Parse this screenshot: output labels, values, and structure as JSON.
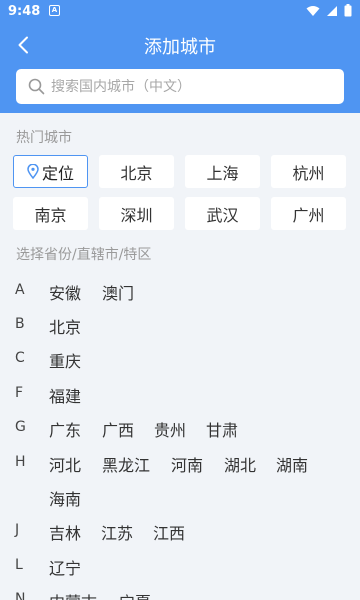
{
  "status": {
    "time": "9:48",
    "notif_icon": "A"
  },
  "nav": {
    "title": "添加城市"
  },
  "search": {
    "placeholder": "搜索国内城市（中文）"
  },
  "hot": {
    "label": "热门城市",
    "locate_label": "定位",
    "cities": [
      "北京",
      "上海",
      "杭州",
      "南京",
      "深圳",
      "武汉",
      "广州"
    ]
  },
  "provinces": {
    "label": "选择省份/直辖市/特区",
    "groups": [
      {
        "letter": "A",
        "items": [
          "安徽",
          "澳门"
        ]
      },
      {
        "letter": "B",
        "items": [
          "北京"
        ]
      },
      {
        "letter": "C",
        "items": [
          "重庆"
        ]
      },
      {
        "letter": "F",
        "items": [
          "福建"
        ]
      },
      {
        "letter": "G",
        "items": [
          "广东",
          "广西",
          "贵州",
          "甘肃"
        ]
      },
      {
        "letter": "H",
        "items": [
          "河北",
          "黑龙江",
          "河南",
          "湖北",
          "湖南"
        ]
      },
      {
        "letter": "",
        "items": [
          "海南"
        ]
      },
      {
        "letter": "J",
        "items": [
          "吉林",
          "江苏",
          "江西"
        ]
      },
      {
        "letter": "L",
        "items": [
          "辽宁"
        ]
      },
      {
        "letter": "N",
        "items": [
          "内蒙古",
          "宁夏"
        ]
      }
    ]
  },
  "colors": {
    "primary": "#4f95f2",
    "background": "#f1f4f8"
  }
}
